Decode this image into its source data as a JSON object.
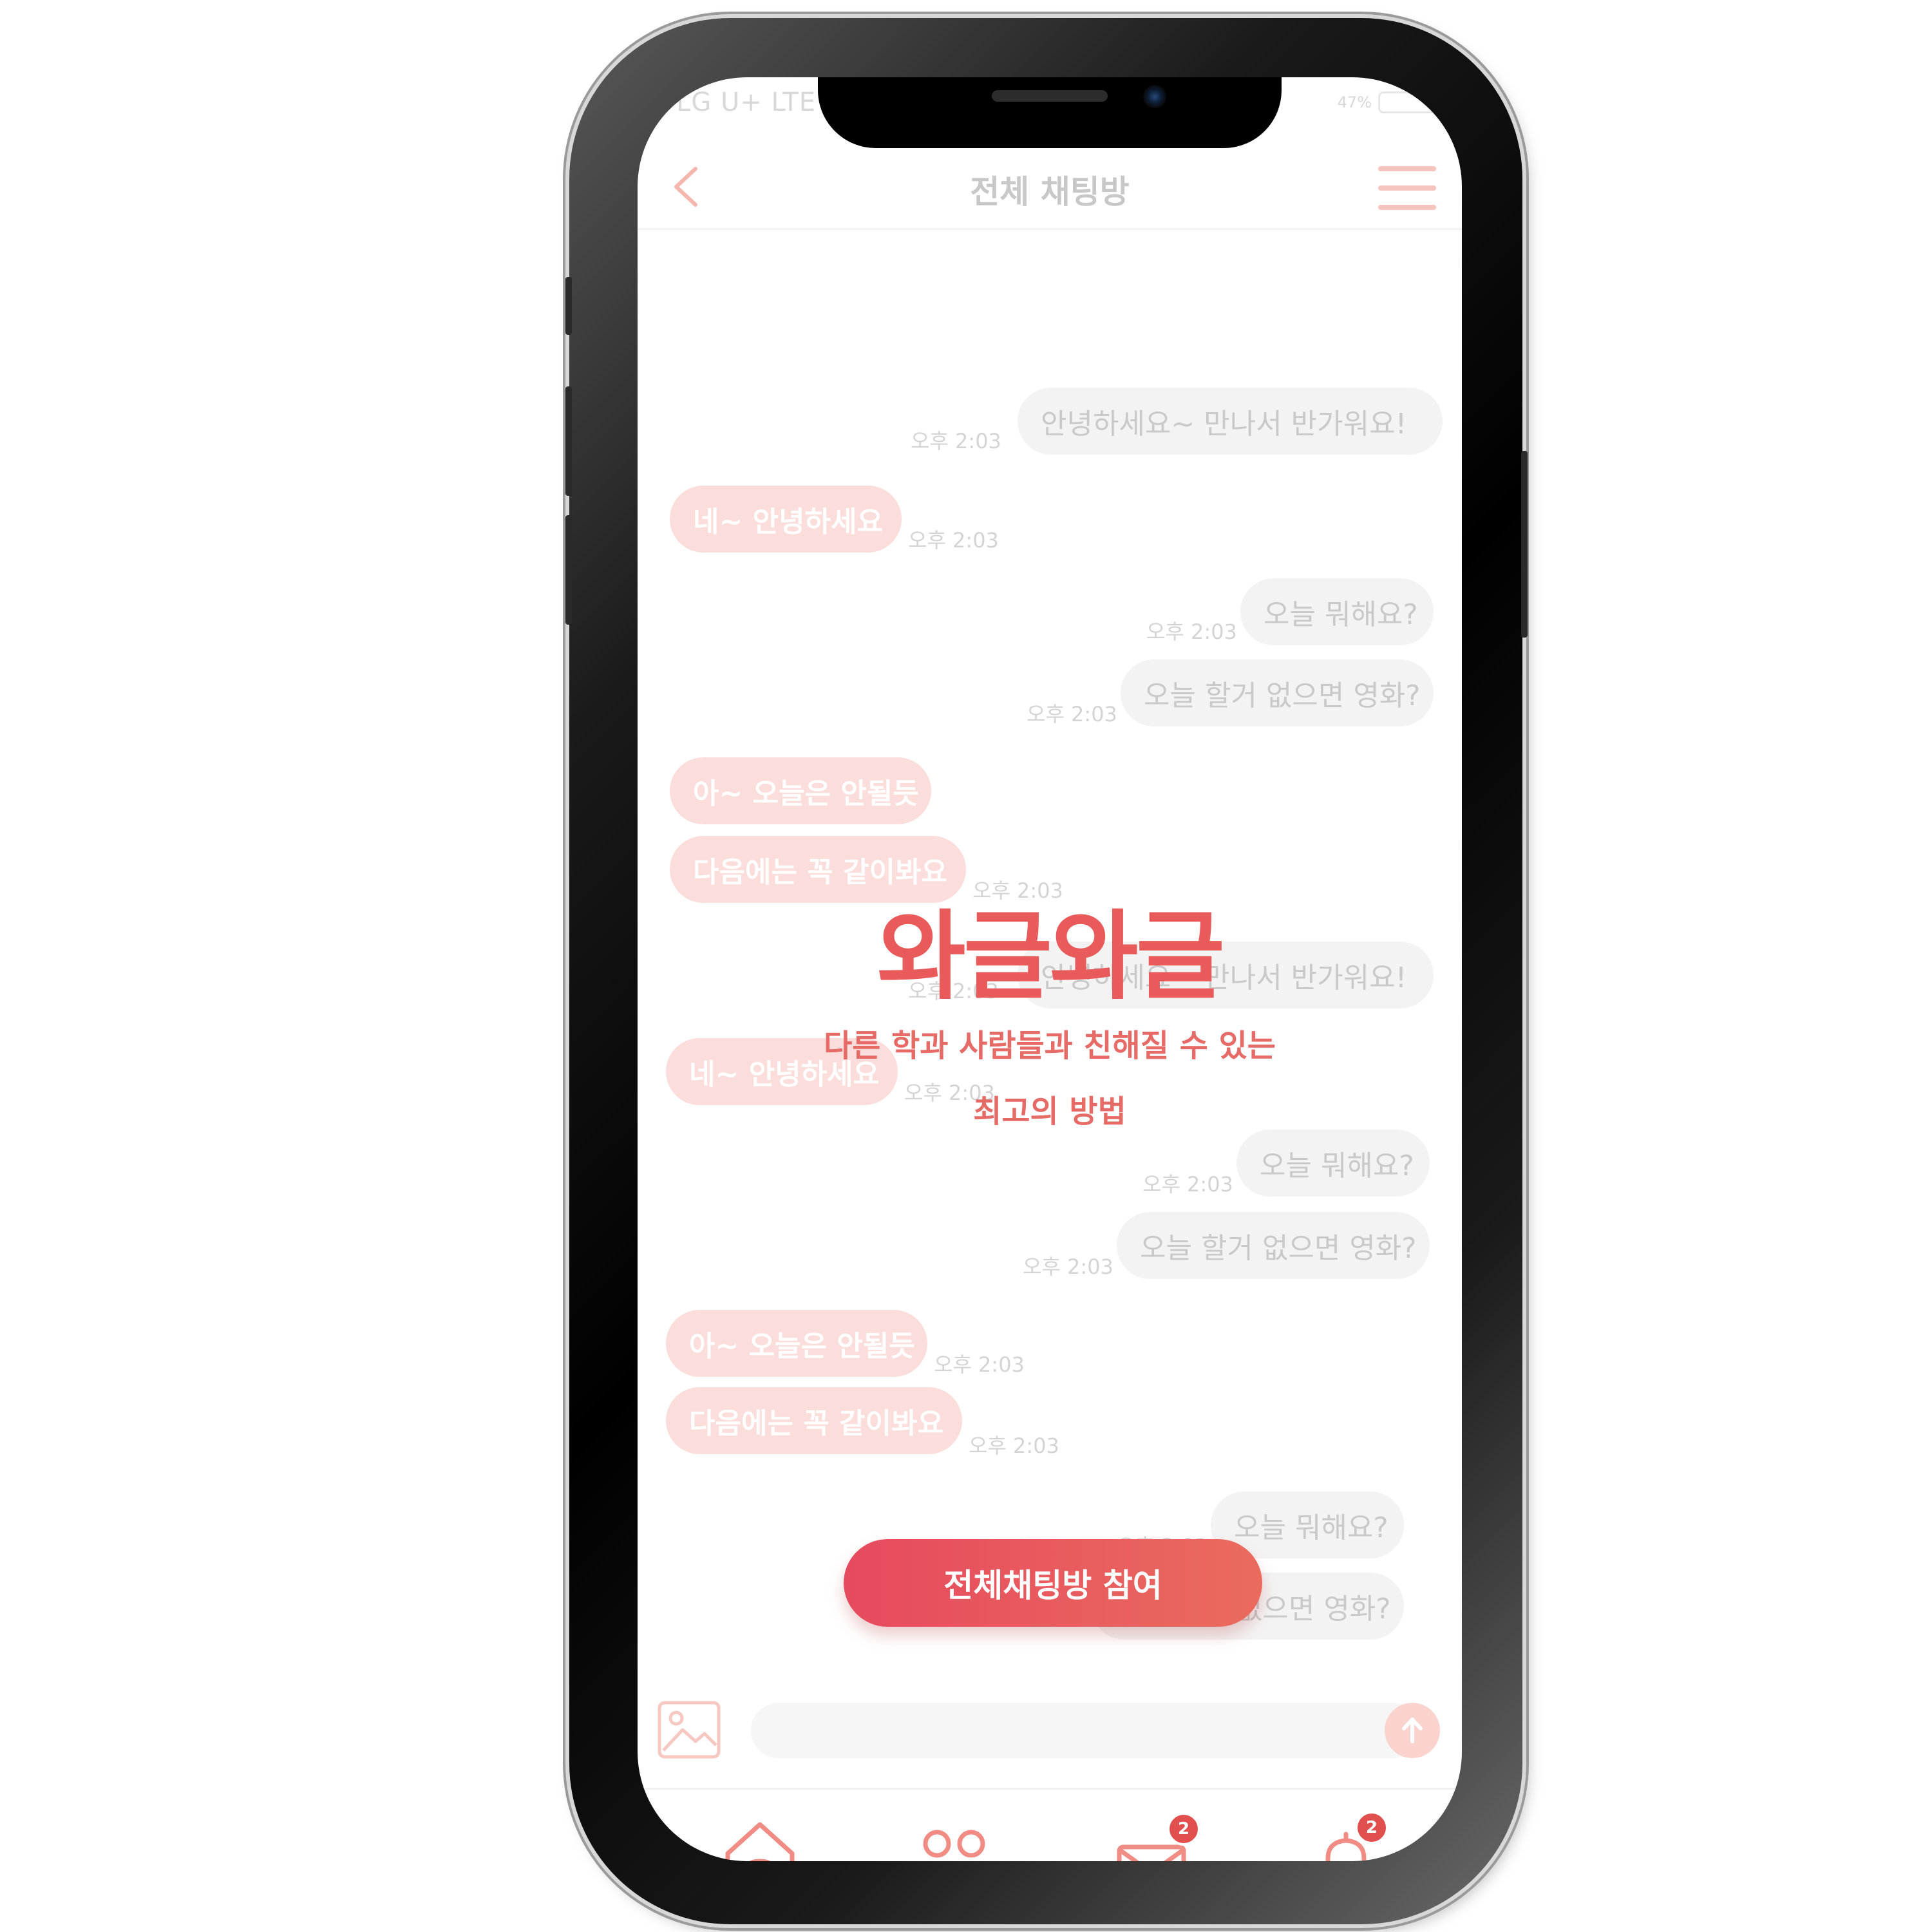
{
  "status_bar": {
    "carrier": "LG U+ LTE",
    "battery": "47%"
  },
  "header": {
    "title": "전체 채팅방"
  },
  "messages": [
    {
      "side": "me",
      "text": "안녕하세요~ 만나서 반가워요!",
      "time": "오후 2:03"
    },
    {
      "side": "them",
      "text": "네~ 안녕하세요",
      "time": "오후 2:03"
    },
    {
      "side": "me",
      "text": "오늘 뭐해요?",
      "time": "오후 2:03"
    },
    {
      "side": "me",
      "text": "오늘 할거 없으면 영화?",
      "time": "오후 2:03"
    },
    {
      "side": "them",
      "text": "아~ 오늘은 안될듯",
      "time": "오후 2:03"
    },
    {
      "side": "them",
      "text": "다음에는 꼭 같이봐요",
      "time": "오후 2:03"
    },
    {
      "side": "me",
      "text": "안녕하세요~ 만나서 반가워요!",
      "time": "오후 2:03"
    },
    {
      "side": "them",
      "text": "네~ 안녕하세요",
      "time": "오후 2:03"
    },
    {
      "side": "me",
      "text": "오늘 뭐해요?",
      "time": "오후 2:03"
    },
    {
      "side": "me",
      "text": "오늘 할거 없으면 영화?",
      "time": "오후 2:03"
    },
    {
      "side": "them",
      "text": "아~ 오늘은 안될듯",
      "time": "오후 2:03"
    },
    {
      "side": "them",
      "text": "다음에는 꼭 같이봐요",
      "time": "오후 2:03"
    },
    {
      "side": "me",
      "text": "오늘 뭐해요?",
      "time": "오후 2:03"
    },
    {
      "side": "me",
      "text": "오늘 할거 없으면 영화?",
      "time": "오후 2:03"
    }
  ],
  "promo": {
    "brand": "와글와글",
    "tagline_line1": "다른 학과 사람들과 친해질 수 있는",
    "tagline_line2": "최고의 방법",
    "join_button": "전체채팅방 참여"
  },
  "input": {
    "placeholder": ""
  },
  "tabs": [
    {
      "icon": "home-icon"
    },
    {
      "icon": "friends-icon"
    },
    {
      "icon": "mail-icon",
      "badge": "2"
    },
    {
      "icon": "bell-icon",
      "badge": "2"
    }
  ],
  "colors": {
    "accent": "#e95b5b",
    "bubble_them": "#fbdedb",
    "bubble_me": "#f3f3f3",
    "icon_line": "#f08c84"
  }
}
